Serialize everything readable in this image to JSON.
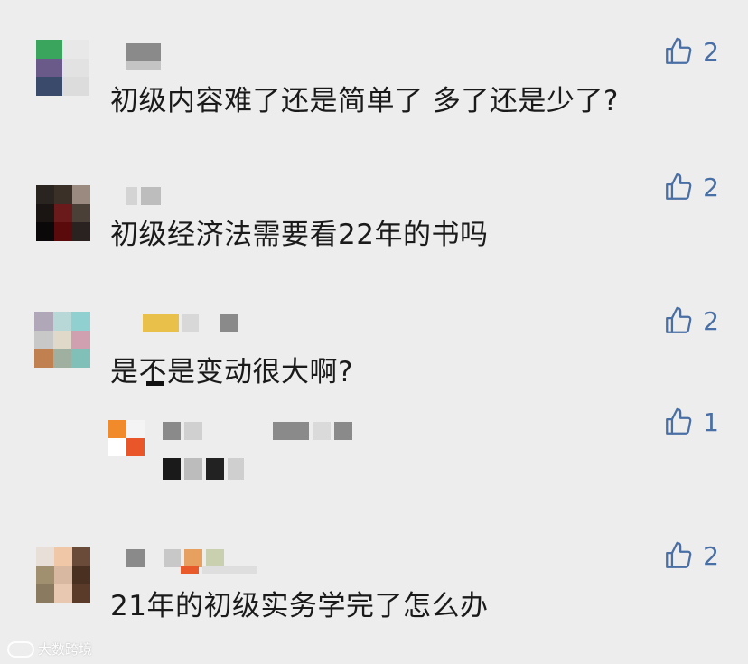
{
  "comments": [
    {
      "text": "初级内容难了还是简单了 多了还是少了?",
      "likes": "2"
    },
    {
      "text": "初级经济法需要看22年的书吗",
      "likes": "2"
    },
    {
      "text": "是不是变动很大啊?",
      "likes": "2"
    },
    {
      "text": "",
      "likes": "1"
    },
    {
      "text": "21年的初级实务学完了怎么办",
      "likes": "2"
    }
  ],
  "watermark": {
    "text": "大数跨境"
  },
  "colors": {
    "like_icon": "#4a6fa5",
    "background": "#ededed"
  },
  "icons": {
    "like": "thumbs-up-icon"
  }
}
